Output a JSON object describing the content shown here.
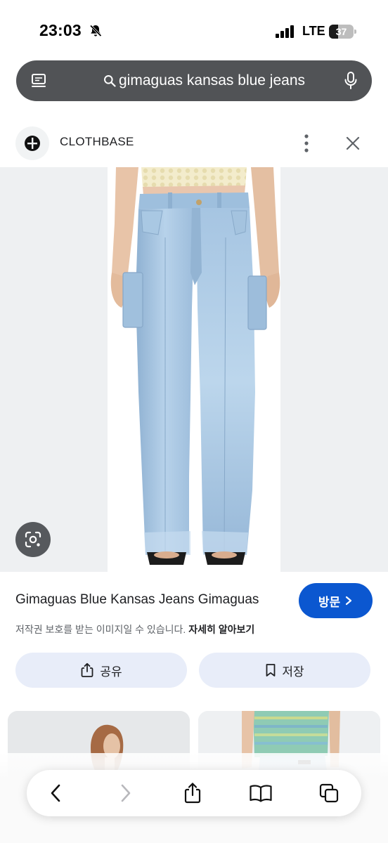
{
  "status_bar": {
    "time": "23:03",
    "network": "LTE",
    "battery_level": "37",
    "battery_fraction": 0.37
  },
  "search": {
    "query": "gimaguas kansas blue jeans"
  },
  "source": {
    "name": "CLOTHBASE"
  },
  "result": {
    "title": "Gimaguas Blue Kansas Jeans Gimaguas",
    "visit_label": "방문",
    "copyright_text": "저작권 보호를 받는 이미지일 수 있습니다.",
    "learn_more_label": "자세히 알아보기",
    "share_label": "공유",
    "save_label": "저장"
  },
  "colors": {
    "accent": "#0b57d0",
    "search_bar": "#515356",
    "action_button_bg": "#e8edf9",
    "denim": "#a9c8e2",
    "image_bg": "#eef0f2"
  },
  "icons": {
    "status": [
      "bell-slash-icon",
      "signal-icon",
      "battery-icon"
    ],
    "search_bar": [
      "tab-switcher-icon",
      "search-icon",
      "mic-icon"
    ],
    "header": [
      "clothbase-logo-icon",
      "more-vert-icon",
      "close-icon"
    ],
    "toolbar": [
      "back-icon",
      "forward-icon",
      "share-icon",
      "bookmarks-icon",
      "tabs-icon"
    ]
  }
}
